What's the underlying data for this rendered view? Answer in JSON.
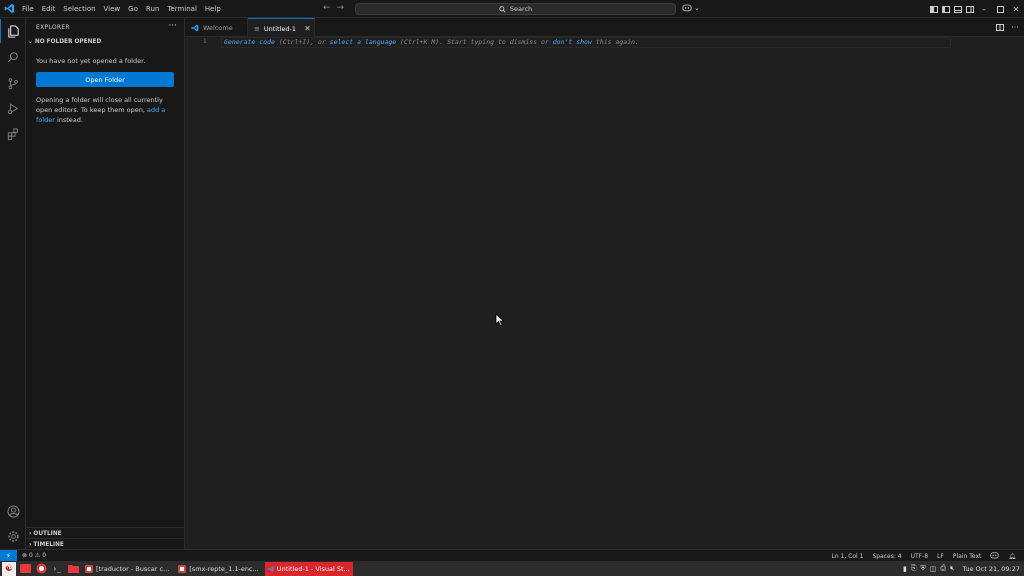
{
  "app": {
    "menu": [
      "File",
      "Edit",
      "Selection",
      "View",
      "Go",
      "Run",
      "Terminal",
      "Help"
    ],
    "search_label": "Search",
    "accent": "#0078d4"
  },
  "sidebar": {
    "title": "EXPLORER",
    "no_folder_header": "NO FOLDER OPENED",
    "message": "You have not yet opened a folder.",
    "open_folder_button": "Open Folder",
    "info_before": "Opening a folder will close all currently open editors. To keep them open, ",
    "info_link": "add a folder",
    "info_after": " instead.",
    "outline": "OUTLINE",
    "timeline": "TIMELINE"
  },
  "tabs": [
    {
      "label": "Welcome",
      "active": false
    },
    {
      "label": "Untitled-1",
      "active": true
    }
  ],
  "editor": {
    "line_number": "1",
    "hint": {
      "link1": "Generate code",
      "text1": " (Ctrl+I), or ",
      "link2": "select a language",
      "text2": " (Ctrl+K M). Start typing to dismiss or ",
      "link3": "don't show",
      "text3": " this again."
    }
  },
  "statusbar": {
    "errors": "0",
    "warnings": "0",
    "position": "Ln 1, Col 1",
    "spaces": "Spaces: 4",
    "encoding": "UTF-8",
    "eol": "LF",
    "language": "Plain Text"
  },
  "taskbar": {
    "windows": [
      {
        "label": "[traductor - Buscar c...",
        "active": false
      },
      {
        "label": "[smx-repte_1.1-enc...",
        "active": false
      },
      {
        "label": "Untitled-1 - Visual St...",
        "active": true
      }
    ],
    "clock": "Tue Oct 21, 09:27"
  }
}
